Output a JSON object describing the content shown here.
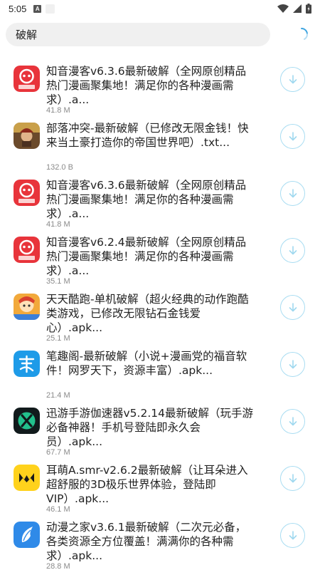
{
  "status_bar": {
    "time": "5:05",
    "a_icon": "A"
  },
  "search": {
    "query": "破解"
  },
  "items": [
    {
      "title": "知音漫客v6.3.6最新破解（全网原创精品热门漫画聚集地！满足你的各种漫画需求）.a...",
      "size": "41.8 M",
      "icon": "zhiyin-manke-icon"
    },
    {
      "title": "部落冲突-最新破解（已修改无限金钱！快来当土豪打造你的帝国世界吧）.txt...",
      "size": "132.0 B",
      "icon": "clash-of-clans-icon"
    },
    {
      "title": "知音漫客v6.3.6最新破解（全网原创精品热门漫画聚集地！满足你的各种漫画需求）.a...",
      "size": "41.8 M",
      "icon": "zhiyin-manke-icon"
    },
    {
      "title": "知音漫客v6.2.4最新破解（全网原创精品热门漫画聚集地！满足你的各种漫画需求）.a...",
      "size": "35.1 M",
      "icon": "zhiyin-manke-icon"
    },
    {
      "title": "天天酷跑-单机破解（超火经典的动作跑酷类游戏，已修改无限钻石金钱爱心）.apk...",
      "size": "25.1 M",
      "icon": "tiantian-kupao-icon"
    },
    {
      "title": "笔趣阁-最新破解（小说+漫画党的福音软件！网罗天下，资源丰富）.apk...",
      "size": "21.4 M",
      "icon": "biquge-icon"
    },
    {
      "title": "迅游手游伽速器v5.2.14最新破解（玩手游必备神器！手机号登陆即永久会员）.apk...",
      "size": "67.7 M",
      "icon": "xunyou-icon"
    },
    {
      "title": "耳萌A.smr-v2.6.2最新破解（让耳朵进入超舒服的3D极乐世界体验，登陆即VIP）.apk...",
      "size": "46.1 M",
      "icon": "ermeng-icon"
    },
    {
      "title": "动漫之家v3.6.1最新破解（二次元必备，各类资源全方位覆盖！满满你的各种需求）.apk...",
      "size": "28.8 M",
      "icon": "dongman-zhijia-icon"
    }
  ],
  "colors": {
    "accent": "#9fd8ef",
    "search_bg": "#f0f0f0",
    "size_text": "#8a8a8a"
  }
}
